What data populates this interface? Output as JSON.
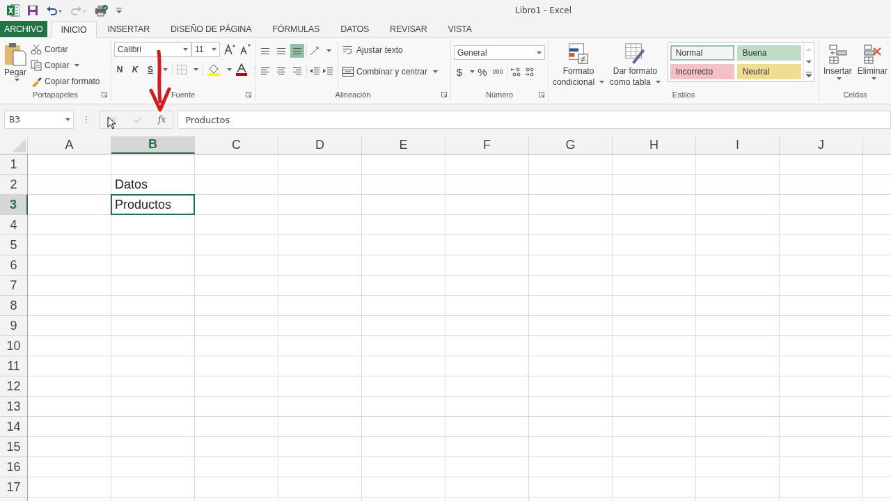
{
  "window": {
    "title": "Libro1 - Excel"
  },
  "tabs": [
    {
      "label": "ARCHIVO",
      "kind": "file",
      "selected": false
    },
    {
      "label": "INICIO",
      "kind": "tab",
      "selected": true
    },
    {
      "label": "INSERTAR",
      "kind": "tab",
      "selected": false
    },
    {
      "label": "DISEÑO DE PÁGINA",
      "kind": "tab",
      "selected": false
    },
    {
      "label": "FÓRMULAS",
      "kind": "tab",
      "selected": false
    },
    {
      "label": "DATOS",
      "kind": "tab",
      "selected": false
    },
    {
      "label": "REVISAR",
      "kind": "tab",
      "selected": false
    },
    {
      "label": "VISTA",
      "kind": "tab",
      "selected": false
    }
  ],
  "ribbon": {
    "clipboard": {
      "label": "Portapapeles",
      "paste": "Pegar",
      "commands": [
        "Cortar",
        "Copiar",
        "Copiar formato"
      ]
    },
    "font": {
      "label": "Fuente",
      "name": "Calibri",
      "size": "11",
      "bold": "N",
      "italic": "K",
      "underline": "S"
    },
    "alignment": {
      "label": "Alineación",
      "wrap": "Ajustar texto",
      "merge": "Combinar y centrar",
      "vertical": [
        {
          "selected": false
        },
        {
          "selected": false
        },
        {
          "selected": true
        }
      ]
    },
    "number": {
      "label": "Número",
      "format": "General",
      "currency": "$",
      "percent": "%",
      "thousands": "000"
    },
    "styles": {
      "label": "Estilos",
      "conditional": [
        "Formato",
        "condicional"
      ],
      "as_table": [
        "Dar formato",
        "como tabla"
      ],
      "gallery": [
        {
          "label": "Normal",
          "color": "#f4f4f4",
          "selected": true
        },
        {
          "label": "Buena",
          "color": "#bfdcc4",
          "selected": false
        },
        {
          "label": "Incorrecto",
          "color": "#f2c0c6",
          "selected": false
        },
        {
          "label": "Neutral",
          "color": "#f0dc94",
          "selected": false
        }
      ]
    },
    "cells": {
      "label": "Celdas",
      "insert": "Insertar",
      "delete": "Eliminar"
    }
  },
  "formula_bar": {
    "name_box": "B3",
    "function": "fx",
    "value": "Productos"
  },
  "sheet": {
    "columns": [
      {
        "label": "A",
        "selected": false
      },
      {
        "label": "B",
        "selected": true
      },
      {
        "label": "C",
        "selected": false
      },
      {
        "label": "D",
        "selected": false
      },
      {
        "label": "E",
        "selected": false
      },
      {
        "label": "F",
        "selected": false
      },
      {
        "label": "G",
        "selected": false
      },
      {
        "label": "H",
        "selected": false
      },
      {
        "label": "I",
        "selected": false
      },
      {
        "label": "J",
        "selected": false
      }
    ],
    "rows": [
      {
        "label": "1",
        "selected": false
      },
      {
        "label": "2",
        "selected": false,
        "cells": {
          "B": {
            "text": "Datos",
            "selected": false
          }
        }
      },
      {
        "label": "3",
        "selected": true,
        "cells": {
          "B": {
            "text": "Productos",
            "selected": true
          }
        }
      },
      {
        "label": "4",
        "selected": false
      },
      {
        "label": "5",
        "selected": false
      },
      {
        "label": "6",
        "selected": false
      },
      {
        "label": "7",
        "selected": false
      },
      {
        "label": "8",
        "selected": false
      },
      {
        "label": "9",
        "selected": false
      },
      {
        "label": "10",
        "selected": false
      },
      {
        "label": "11",
        "selected": false
      },
      {
        "label": "12",
        "selected": false
      },
      {
        "label": "13",
        "selected": false
      },
      {
        "label": "14",
        "selected": false
      },
      {
        "label": "15",
        "selected": false
      },
      {
        "label": "16",
        "selected": false
      },
      {
        "label": "17",
        "selected": false
      }
    ]
  }
}
